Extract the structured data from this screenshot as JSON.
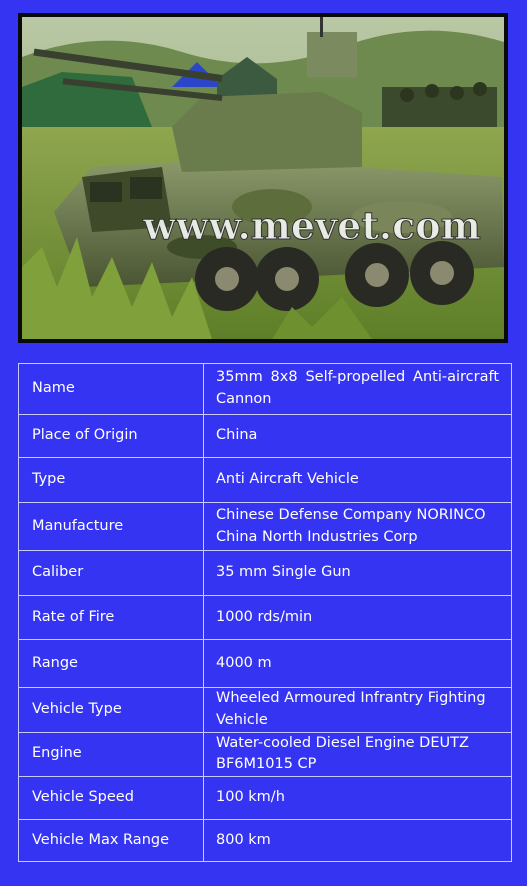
{
  "photo": {
    "alt": "35mm 8x8 Self-propelled Anti-aircraft Cannon",
    "watermark": "www.mevet.com"
  },
  "specs": [
    {
      "label": "Name",
      "value": "35mm 8x8 Self-propelled Anti-aircraft Cannon"
    },
    {
      "label": "Place of Origin",
      "value": "China"
    },
    {
      "label": "Type",
      "value": "Anti Aircraft Vehicle"
    },
    {
      "label": "Manufacture",
      "value": "Chinese Defense Company NORINCO China North Industries Corp"
    },
    {
      "label": "Caliber",
      "value": "35 mm Single Gun"
    },
    {
      "label": "Rate of Fire",
      "value": "1000 rds/min"
    },
    {
      "label": "Range",
      "value": "4000 m"
    },
    {
      "label": "Vehicle Type",
      "value": "Wheeled Armoured Infrantry Fighting Vehicle"
    },
    {
      "label": "Engine",
      "value": "Water-cooled Diesel Engine DEUTZ BF6M1015 CP"
    },
    {
      "label": "Vehicle Speed",
      "value": "100 km/h"
    },
    {
      "label": "Vehicle Max Range",
      "value": "800 km"
    }
  ],
  "colors": {
    "background": "#3534f2",
    "border": "#c9c9ff",
    "text": "#ffffff"
  }
}
